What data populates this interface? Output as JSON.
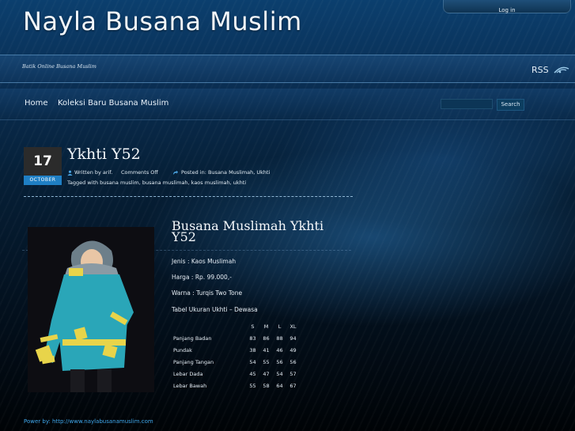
{
  "header": {
    "login_label": "Log in",
    "site_title": "Nayla Busana Muslim",
    "tagline": "Batik Online Busana Muslim",
    "rss_label": "RSS"
  },
  "nav": {
    "items": [
      {
        "label": "Home"
      },
      {
        "label": "Koleksi Baru Busana Muslim"
      }
    ],
    "search_placeholder": "",
    "search_button": "Search"
  },
  "post": {
    "day": "17",
    "month": "OCTOBER",
    "title": "Ykhti Y52",
    "written_by": "Written by arif.",
    "comments": "Comments Off",
    "posted_in": "Posted in: Busana Muslimah, Ukhti",
    "tagged": "Tagged with busana muslim, busana muslimah, kaos muslimah, ukhti"
  },
  "content": {
    "title": "Busana Muslimah Ykhti Y52",
    "jenis": "Jenis     : Kaos Muslimah",
    "harga": "Harga    : Rp. 99.000,-",
    "warna": "Warna   : Turqis Two Tone",
    "tabel_title": "Tabel Ukuran Ukhti – Dewasa",
    "size_headers": [
      "S",
      "M",
      "L",
      "XL"
    ],
    "size_rows": [
      {
        "name": "Panjang Badan",
        "values": [
          "83",
          "86",
          "88",
          "94"
        ]
      },
      {
        "name": "Pundak",
        "values": [
          "38",
          "41",
          "46",
          "49"
        ]
      },
      {
        "name": "Panjang Tangan",
        "values": [
          "54",
          "55",
          "56",
          "56"
        ]
      },
      {
        "name": "Lebar Dada",
        "values": [
          "45",
          "47",
          "54",
          "57"
        ]
      },
      {
        "name": "Lebar Bawah",
        "values": [
          "55",
          "58",
          "64",
          "67"
        ]
      }
    ]
  },
  "footer": {
    "powered_by": "Power by: http://www.naylabusanamuslim.com"
  },
  "colors": {
    "accent_blue": "#1f7fc4",
    "footer_link": "#3ea6ea",
    "dress_turquoise": "#2aa6b8",
    "dress_trim": "#e8d44a"
  }
}
